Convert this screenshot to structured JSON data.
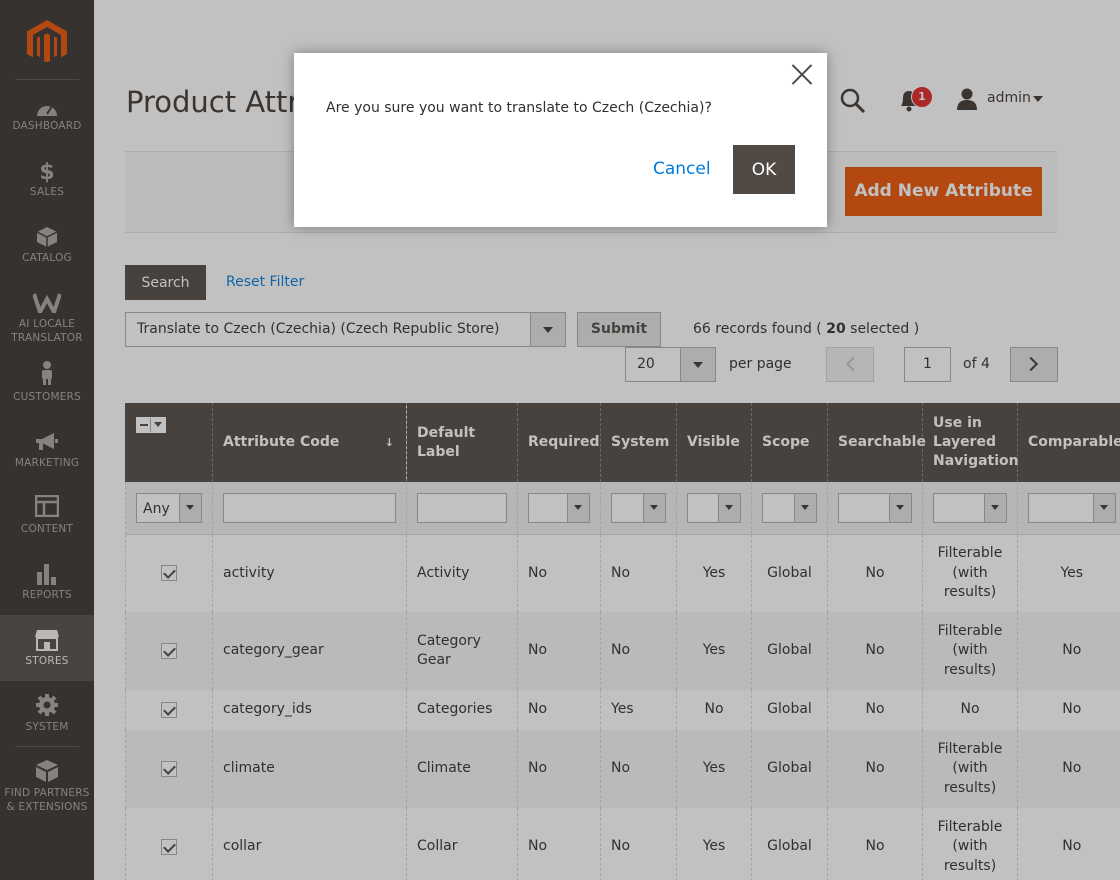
{
  "sidebar": {
    "items": [
      {
        "label": "DASHBOARD",
        "icon": "dashboard-icon"
      },
      {
        "label": "SALES",
        "icon": "dollar-icon"
      },
      {
        "label": "CATALOG",
        "icon": "cube-icon"
      },
      {
        "label": "AI LOCALE TRANSLATOR",
        "icon": "translator-w-icon"
      },
      {
        "label": "CUSTOMERS",
        "icon": "person-icon"
      },
      {
        "label": "MARKETING",
        "icon": "megaphone-icon"
      },
      {
        "label": "CONTENT",
        "icon": "layout-icon"
      },
      {
        "label": "REPORTS",
        "icon": "bar-chart-icon"
      },
      {
        "label": "STORES",
        "icon": "storefront-icon"
      },
      {
        "label": "SYSTEM",
        "icon": "gear-icon"
      },
      {
        "label": "FIND PARTNERS & EXTENSIONS",
        "icon": "blocks-icon"
      }
    ],
    "active": "STORES"
  },
  "header": {
    "title": "Product Attri",
    "notification_count": "1",
    "user": "admin"
  },
  "actions": {
    "add_label": "Add New Attribute"
  },
  "filters": {
    "search_label": "Search",
    "reset_label": "Reset Filter",
    "mass_action": "Translate to Czech (Czechia) (Czech Republic Store)",
    "submit_label": "Submit",
    "records_prefix": "66 records found ( ",
    "selected_count": "20",
    "records_suffix": " selected )"
  },
  "pager": {
    "per_page": "20",
    "per_page_label": "per page",
    "current": "1",
    "of_label": "of 4"
  },
  "grid": {
    "headers": [
      "Attribute Code",
      "Default Label",
      "Required",
      "System",
      "Visible",
      "Scope",
      "Searchable",
      "Use in Layered Navigation",
      "Comparable"
    ],
    "sort_indicator": "↓",
    "filter_any": "Any",
    "rows": [
      {
        "code": "activity",
        "label": "Activity",
        "required": "No",
        "system": "No",
        "visible": "Yes",
        "scope": "Global",
        "searchable": "No",
        "layered": "Filterable (with results)",
        "comparable": "Yes"
      },
      {
        "code": "category_gear",
        "label": "Category Gear",
        "required": "No",
        "system": "No",
        "visible": "Yes",
        "scope": "Global",
        "searchable": "No",
        "layered": "Filterable (with results)",
        "comparable": "No"
      },
      {
        "code": "category_ids",
        "label": "Categories",
        "required": "No",
        "system": "Yes",
        "visible": "No",
        "scope": "Global",
        "searchable": "No",
        "layered": "No",
        "comparable": "No"
      },
      {
        "code": "climate",
        "label": "Climate",
        "required": "No",
        "system": "No",
        "visible": "Yes",
        "scope": "Global",
        "searchable": "No",
        "layered": "Filterable (with results)",
        "comparable": "No"
      },
      {
        "code": "collar",
        "label": "Collar",
        "required": "No",
        "system": "No",
        "visible": "Yes",
        "scope": "Global",
        "searchable": "No",
        "layered": "Filterable (with results)",
        "comparable": "No"
      }
    ]
  },
  "modal": {
    "message": "Are you sure you want to translate to Czech (Czechia)?",
    "cancel_label": "Cancel",
    "ok_label": "OK"
  },
  "colors": {
    "accent": "#eb5202",
    "sidebar": "#373330",
    "link": "#007bdb",
    "header_dark": "#514943"
  }
}
